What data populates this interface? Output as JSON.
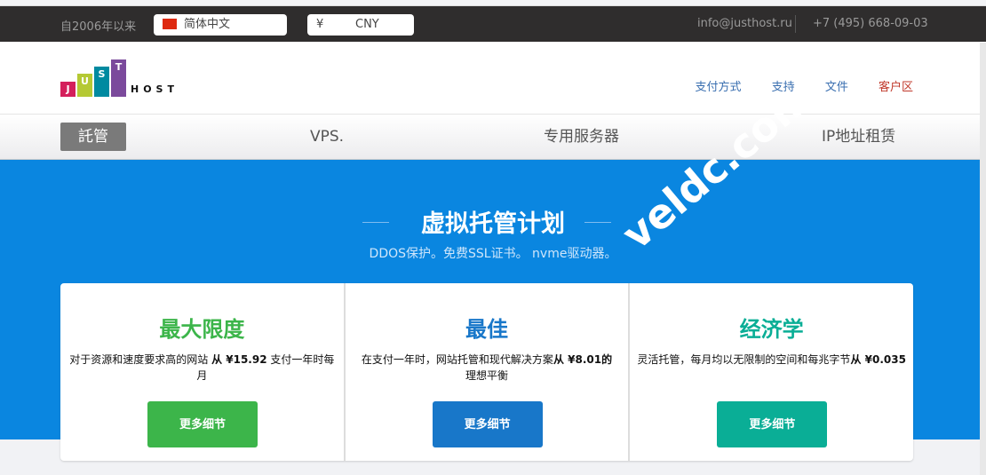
{
  "topbar": {
    "since": "自2006年以来",
    "language": "简体中文",
    "currency_symbol": "¥",
    "currency": "CNY",
    "email": "info@justhost.ru",
    "phone": "+7 (495) 668-09-03"
  },
  "logo": {
    "letters": [
      "J",
      "U",
      "S",
      "T"
    ],
    "word": "HOST",
    "colors": [
      "#d41f5b",
      "#b5c934",
      "#008aa0",
      "#7b4a9c"
    ]
  },
  "header_links": [
    "支付方式",
    "支持",
    "文件",
    "客户区"
  ],
  "nav": [
    "託管",
    "VPS.",
    "专用服务器",
    "IP地址租赁"
  ],
  "hero": {
    "title": "虚拟托管计划",
    "subtitle": "DDOS保护。免费SSL证书。 nvme驱动器。"
  },
  "cards": [
    {
      "title": "最大限度",
      "color": "#3cb54a",
      "desc": "对于资源和速度要求高的网站 ",
      "price": "从 ¥15.92",
      "desc2": " 支付一年时每月",
      "button": "更多细节"
    },
    {
      "title": "最佳",
      "color": "#1877c9",
      "desc": "在支付一年时，网站托管和现代解决方案",
      "price": "从 ¥8.01的",
      "desc2": "理想平衡",
      "button": "更多细节"
    },
    {
      "title": "经济学",
      "color": "#0aae96",
      "desc": "灵活托管，每月均以无限制的空间和每兆字节",
      "price": "从 ¥0.035",
      "desc2": "",
      "button": "更多细节"
    }
  ],
  "watermark": "veldc.com"
}
